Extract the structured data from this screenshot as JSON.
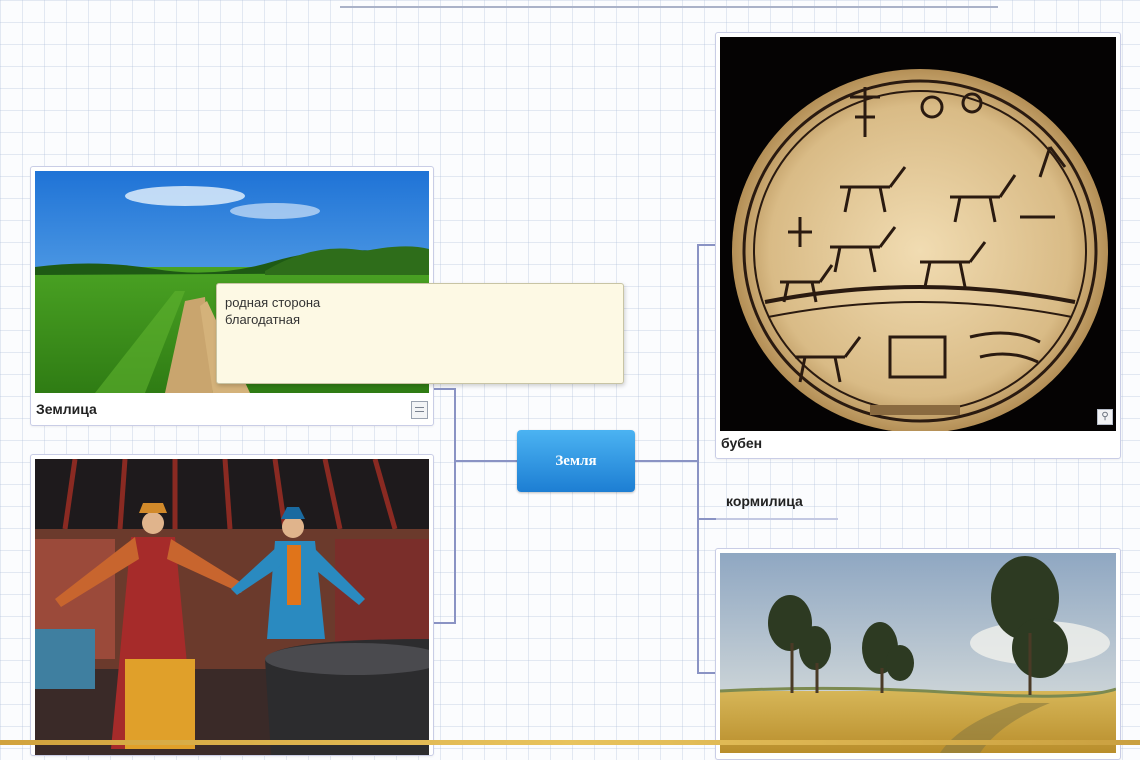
{
  "mindmap": {
    "root": {
      "label": "Земля"
    },
    "nodes": [
      {
        "id": "zemlitsa",
        "caption": "Землица",
        "note": {
          "lines": [
            "родная сторона",
            "благодатная"
          ]
        }
      },
      {
        "id": "people",
        "caption": ""
      },
      {
        "id": "buben",
        "caption": "бубен"
      },
      {
        "id": "kormilitsa",
        "caption": "кормилица"
      },
      {
        "id": "field",
        "caption": ""
      }
    ]
  },
  "icons": {
    "note": "note-icon",
    "zoom": "magnifier-icon"
  },
  "colors": {
    "root_top": "#4bb3f2",
    "root_bottom": "#1d7ed3",
    "connector": "#8a93c4",
    "note_bg": "#fdf9e4"
  }
}
